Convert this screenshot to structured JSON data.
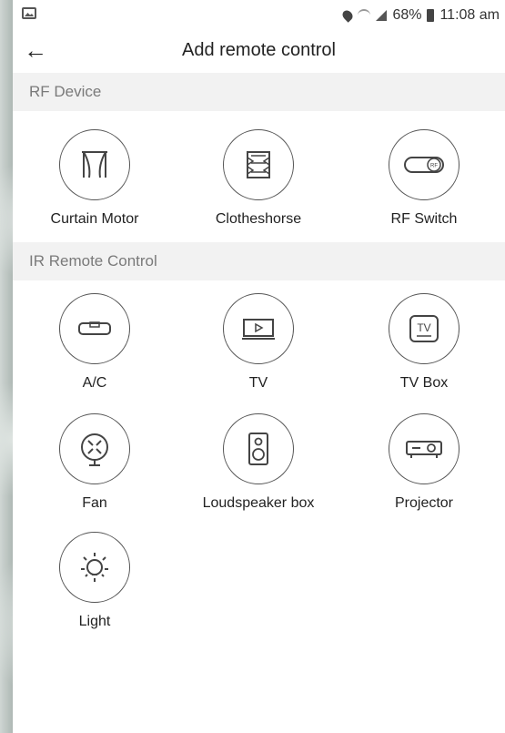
{
  "status": {
    "battery": "68%",
    "time": "11:08 am"
  },
  "header": {
    "title": "Add remote control"
  },
  "sections": [
    {
      "title": "RF Device",
      "items": [
        {
          "label": "Curtain Motor",
          "icon": "curtain-icon"
        },
        {
          "label": "Clotheshorse",
          "icon": "clotheshorse-icon"
        },
        {
          "label": "RF Switch",
          "icon": "rf-switch-icon"
        }
      ]
    },
    {
      "title": "IR Remote Control",
      "items": [
        {
          "label": "A/C",
          "icon": "ac-icon"
        },
        {
          "label": "TV",
          "icon": "tv-icon"
        },
        {
          "label": "TV Box",
          "icon": "tv-box-icon"
        },
        {
          "label": "Fan",
          "icon": "fan-icon"
        },
        {
          "label": "Loudspeaker box",
          "icon": "loudspeaker-icon"
        },
        {
          "label": "Projector",
          "icon": "projector-icon"
        },
        {
          "label": "Light",
          "icon": "light-icon"
        }
      ]
    }
  ]
}
